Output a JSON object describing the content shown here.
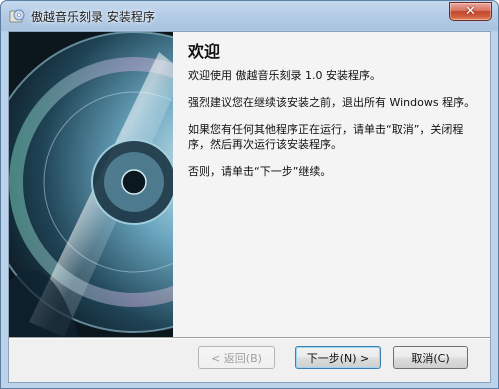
{
  "window": {
    "title": "傲越音乐刻录 安装程序",
    "close_label": "✕"
  },
  "page": {
    "heading": "欢迎",
    "paragraphs": [
      "欢迎使用 傲越音乐刻录 1.0 安装程序。",
      "强烈建议您在继续该安装之前，退出所有 Windows 程序。",
      "如果您有任何其他程序正在运行，请单击“取消”，关闭程序，然后再次运行该安装程序。",
      "否则，请单击“下一步”继续。"
    ]
  },
  "buttons": {
    "back": "< 返回(B)",
    "next": "下一步(N) >",
    "cancel": "取消(C)"
  },
  "colors": {
    "titlebar": "#b4cce6",
    "close_button": "#c1452e",
    "panel": "#f4f4f4",
    "banner_dark": "#0c1820"
  },
  "icons": {
    "title": "installer-disc-icon",
    "close": "close-icon",
    "banner": "cd-disc-image"
  }
}
